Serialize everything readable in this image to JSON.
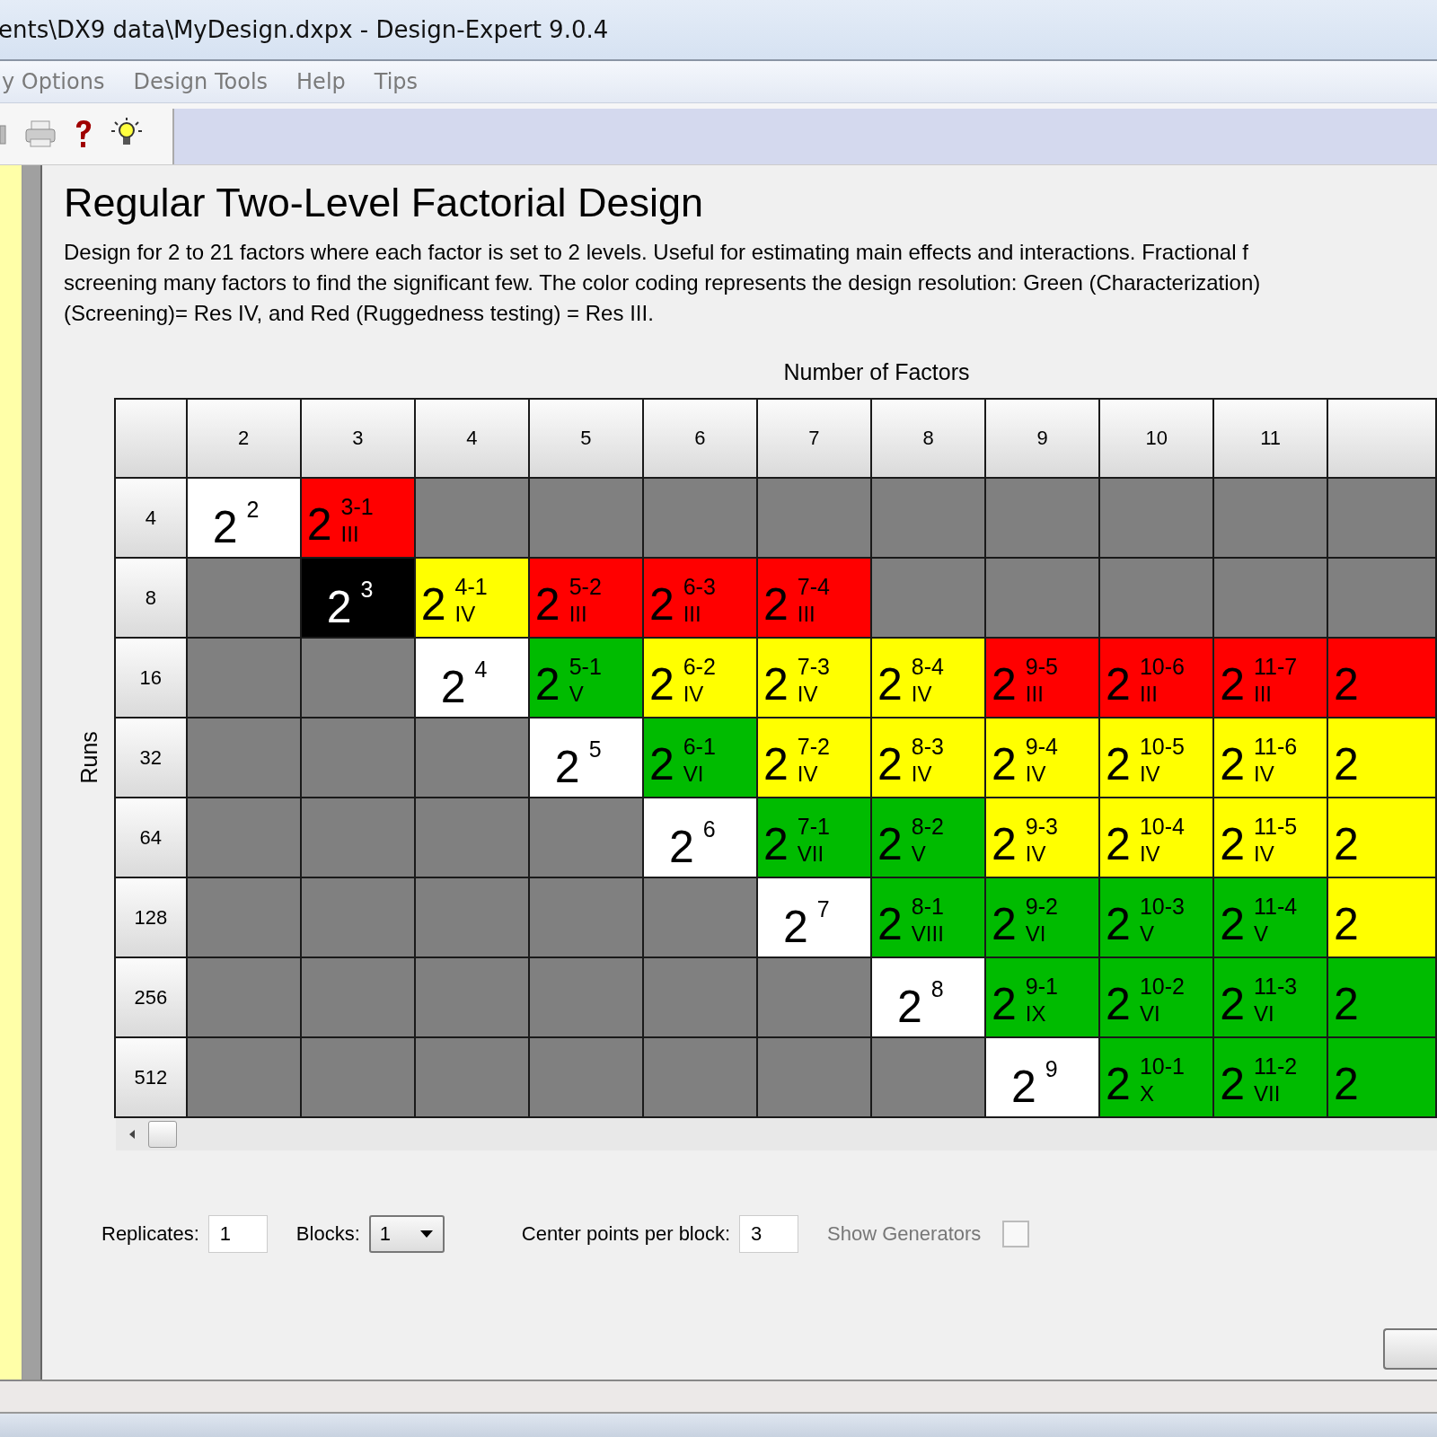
{
  "window": {
    "title": "ents\\DX9 data\\MyDesign.dxpx - Design-Expert 9.0.4"
  },
  "menu": [
    "y Options",
    "Design Tools",
    "Help",
    "Tips"
  ],
  "heading": "Regular Two-Level Factorial Design",
  "description": [
    "Design for 2 to 21 factors where each factor is set to 2 levels.  Useful for estimating main effects and interactions.  Fractional f",
    "screening many factors to find the significant few. The color coding represents the design resolution: Green (Characterization)",
    "(Screening)= Res IV, and Red (Ruggedness testing) = Res III."
  ],
  "grid": {
    "column_title": "Number of Factors",
    "row_title": "Runs",
    "columns": [
      "2",
      "3",
      "4",
      "5",
      "6",
      "7",
      "8",
      "9",
      "10",
      "11"
    ],
    "rows": [
      {
        "label": "4",
        "cells": [
          {
            "kind": "full",
            "base": "2",
            "exp": "2",
            "selected": false
          },
          {
            "kind": "fraction",
            "base": "2",
            "exp": "3-1",
            "res": "III",
            "color": "#ff0000",
            "selected": false
          },
          {
            "kind": "none"
          },
          {
            "kind": "none"
          },
          {
            "kind": "none"
          },
          {
            "kind": "none"
          },
          {
            "kind": "none"
          },
          {
            "kind": "none"
          },
          {
            "kind": "none"
          },
          {
            "kind": "none"
          },
          {
            "kind": "none"
          }
        ]
      },
      {
        "label": "8",
        "cells": [
          {
            "kind": "none"
          },
          {
            "kind": "full",
            "base": "2",
            "exp": "3",
            "selected": true
          },
          {
            "kind": "fraction",
            "base": "2",
            "exp": "4-1",
            "res": "IV",
            "color": "#ffff00",
            "selected": false
          },
          {
            "kind": "fraction",
            "base": "2",
            "exp": "5-2",
            "res": "III",
            "color": "#ff0000",
            "selected": false
          },
          {
            "kind": "fraction",
            "base": "2",
            "exp": "6-3",
            "res": "III",
            "color": "#ff0000",
            "selected": false
          },
          {
            "kind": "fraction",
            "base": "2",
            "exp": "7-4",
            "res": "III",
            "color": "#ff0000",
            "selected": false
          },
          {
            "kind": "none"
          },
          {
            "kind": "none"
          },
          {
            "kind": "none"
          },
          {
            "kind": "none"
          },
          {
            "kind": "none"
          }
        ]
      },
      {
        "label": "16",
        "cells": [
          {
            "kind": "none"
          },
          {
            "kind": "none"
          },
          {
            "kind": "full",
            "base": "2",
            "exp": "4",
            "selected": false
          },
          {
            "kind": "fraction",
            "base": "2",
            "exp": "5-1",
            "res": "V",
            "color": "#00bb00",
            "selected": false
          },
          {
            "kind": "fraction",
            "base": "2",
            "exp": "6-2",
            "res": "IV",
            "color": "#ffff00",
            "selected": false
          },
          {
            "kind": "fraction",
            "base": "2",
            "exp": "7-3",
            "res": "IV",
            "color": "#ffff00",
            "selected": false
          },
          {
            "kind": "fraction",
            "base": "2",
            "exp": "8-4",
            "res": "IV",
            "color": "#ffff00",
            "selected": false
          },
          {
            "kind": "fraction",
            "base": "2",
            "exp": "9-5",
            "res": "III",
            "color": "#ff0000",
            "selected": false
          },
          {
            "kind": "fraction",
            "base": "2",
            "exp": "10-6",
            "res": "III",
            "color": "#ff0000",
            "selected": false
          },
          {
            "kind": "fraction",
            "base": "2",
            "exp": "11-7",
            "res": "III",
            "color": "#ff0000",
            "selected": false
          },
          {
            "kind": "fraction",
            "base": "2",
            "color": "#ff0000",
            "selected": false
          }
        ]
      },
      {
        "label": "32",
        "cells": [
          {
            "kind": "none"
          },
          {
            "kind": "none"
          },
          {
            "kind": "none"
          },
          {
            "kind": "full",
            "base": "2",
            "exp": "5",
            "selected": false
          },
          {
            "kind": "fraction",
            "base": "2",
            "exp": "6-1",
            "res": "VI",
            "color": "#00bb00",
            "selected": false
          },
          {
            "kind": "fraction",
            "base": "2",
            "exp": "7-2",
            "res": "IV",
            "color": "#ffff00",
            "selected": false
          },
          {
            "kind": "fraction",
            "base": "2",
            "exp": "8-3",
            "res": "IV",
            "color": "#ffff00",
            "selected": false
          },
          {
            "kind": "fraction",
            "base": "2",
            "exp": "9-4",
            "res": "IV",
            "color": "#ffff00",
            "selected": false
          },
          {
            "kind": "fraction",
            "base": "2",
            "exp": "10-5",
            "res": "IV",
            "color": "#ffff00",
            "selected": false
          },
          {
            "kind": "fraction",
            "base": "2",
            "exp": "11-6",
            "res": "IV",
            "color": "#ffff00",
            "selected": false
          },
          {
            "kind": "fraction",
            "base": "2",
            "color": "#ffff00",
            "selected": false
          }
        ]
      },
      {
        "label": "64",
        "cells": [
          {
            "kind": "none"
          },
          {
            "kind": "none"
          },
          {
            "kind": "none"
          },
          {
            "kind": "none"
          },
          {
            "kind": "full",
            "base": "2",
            "exp": "6",
            "selected": false
          },
          {
            "kind": "fraction",
            "base": "2",
            "exp": "7-1",
            "res": "VII",
            "color": "#00bb00",
            "selected": false
          },
          {
            "kind": "fraction",
            "base": "2",
            "exp": "8-2",
            "res": "V",
            "color": "#00bb00",
            "selected": false
          },
          {
            "kind": "fraction",
            "base": "2",
            "exp": "9-3",
            "res": "IV",
            "color": "#ffff00",
            "selected": false
          },
          {
            "kind": "fraction",
            "base": "2",
            "exp": "10-4",
            "res": "IV",
            "color": "#ffff00",
            "selected": false
          },
          {
            "kind": "fraction",
            "base": "2",
            "exp": "11-5",
            "res": "IV",
            "color": "#ffff00",
            "selected": false
          },
          {
            "kind": "fraction",
            "base": "2",
            "color": "#ffff00",
            "selected": false
          }
        ]
      },
      {
        "label": "128",
        "cells": [
          {
            "kind": "none"
          },
          {
            "kind": "none"
          },
          {
            "kind": "none"
          },
          {
            "kind": "none"
          },
          {
            "kind": "none"
          },
          {
            "kind": "full",
            "base": "2",
            "exp": "7",
            "selected": false
          },
          {
            "kind": "fraction",
            "base": "2",
            "exp": "8-1",
            "res": "VIII",
            "color": "#00bb00",
            "selected": false
          },
          {
            "kind": "fraction",
            "base": "2",
            "exp": "9-2",
            "res": "VI",
            "color": "#00bb00",
            "selected": false
          },
          {
            "kind": "fraction",
            "base": "2",
            "exp": "10-3",
            "res": "V",
            "color": "#00bb00",
            "selected": false
          },
          {
            "kind": "fraction",
            "base": "2",
            "exp": "11-4",
            "res": "V",
            "color": "#00bb00",
            "selected": false
          },
          {
            "kind": "fraction",
            "base": "2",
            "color": "#ffff00",
            "selected": false
          }
        ]
      },
      {
        "label": "256",
        "cells": [
          {
            "kind": "none"
          },
          {
            "kind": "none"
          },
          {
            "kind": "none"
          },
          {
            "kind": "none"
          },
          {
            "kind": "none"
          },
          {
            "kind": "none"
          },
          {
            "kind": "full",
            "base": "2",
            "exp": "8",
            "selected": false
          },
          {
            "kind": "fraction",
            "base": "2",
            "exp": "9-1",
            "res": "IX",
            "color": "#00bb00",
            "selected": false
          },
          {
            "kind": "fraction",
            "base": "2",
            "exp": "10-2",
            "res": "VI",
            "color": "#00bb00",
            "selected": false
          },
          {
            "kind": "fraction",
            "base": "2",
            "exp": "11-3",
            "res": "VI",
            "color": "#00bb00",
            "selected": false
          },
          {
            "kind": "fraction",
            "base": "2",
            "color": "#00bb00",
            "selected": false
          }
        ]
      },
      {
        "label": "512",
        "cells": [
          {
            "kind": "none"
          },
          {
            "kind": "none"
          },
          {
            "kind": "none"
          },
          {
            "kind": "none"
          },
          {
            "kind": "none"
          },
          {
            "kind": "none"
          },
          {
            "kind": "none"
          },
          {
            "kind": "full",
            "base": "2",
            "exp": "9",
            "selected": false
          },
          {
            "kind": "fraction",
            "base": "2",
            "exp": "10-1",
            "res": "X",
            "color": "#00bb00",
            "selected": false
          },
          {
            "kind": "fraction",
            "base": "2",
            "exp": "11-2",
            "res": "VII",
            "color": "#00bb00",
            "selected": false
          },
          {
            "kind": "fraction",
            "base": "2",
            "color": "#00bb00",
            "selected": false
          }
        ]
      }
    ]
  },
  "options": {
    "replicates_label": "Replicates:",
    "replicates": "1",
    "blocks_label": "Blocks:",
    "blocks": "1",
    "center_label": "Center points per block:",
    "center_points": "3",
    "generators_label": "Show Generators",
    "show_generators": false
  }
}
